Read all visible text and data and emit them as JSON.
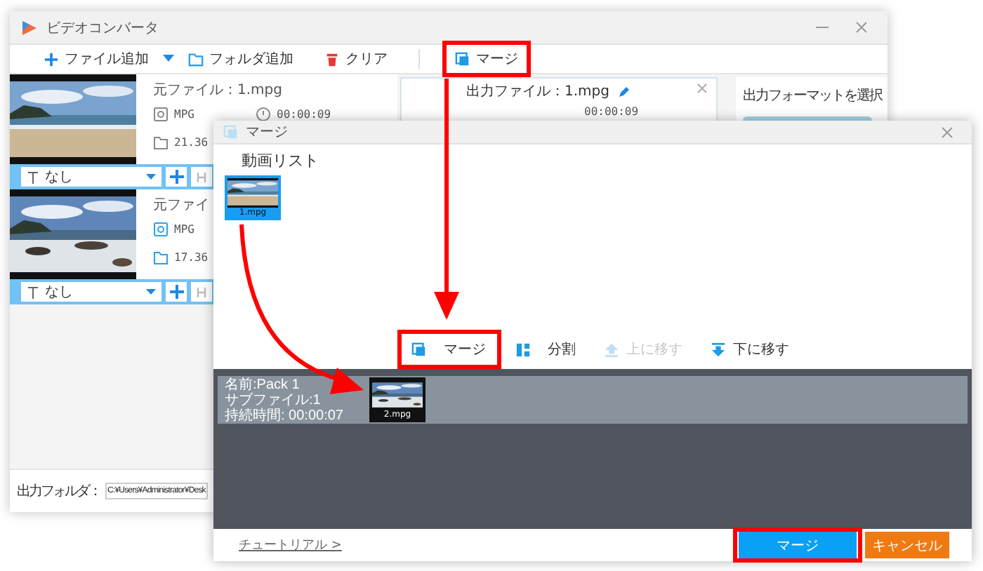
{
  "main_window": {
    "title": "ビデオコンバータ",
    "toolbar": [
      {
        "label": "ファイル追加",
        "kind": "add",
        "highlighted": false
      },
      {
        "label": "フォルダ追加",
        "kind": "folder",
        "highlighted": false
      },
      {
        "label": "クリア",
        "kind": "clear",
        "highlighted": false
      },
      {
        "label": "マージ",
        "kind": "merge",
        "highlighted": true
      }
    ],
    "files": [
      {
        "source": "元ファイル：1.mpg",
        "format": "MPG",
        "duration": "00:00:09",
        "size": "21.36",
        "subtitle": "なし"
      },
      {
        "source": "元ファイ",
        "format": "MPG",
        "size": "17.36",
        "subtitle": "なし"
      }
    ],
    "output_card": {
      "file": "出力ファイル：1.mpg",
      "duration": "00:00:09"
    },
    "format_panel": {
      "title": "出力フォーマットを選択"
    },
    "output_folder": {
      "label": "出力フォルダ：",
      "path": "C:¥Users¥Administrator¥Desk"
    }
  },
  "dialog": {
    "title": "マージ",
    "list_title": "動画リスト",
    "videos": [
      {
        "name": "1.mpg",
        "selected": true
      }
    ],
    "actions": [
      {
        "label": "マージ",
        "kind": "merge",
        "disabled": false,
        "highlighted": true
      },
      {
        "label": "分割",
        "kind": "split",
        "disabled": false,
        "highlighted": false
      },
      {
        "label": "上に移す",
        "kind": "up",
        "disabled": true,
        "highlighted": false
      },
      {
        "label": "下に移す",
        "kind": "down",
        "disabled": false,
        "highlighted": false
      }
    ],
    "packs": [
      {
        "name": "名前:Pack 1",
        "subfiles": "サブファイル:1",
        "duration": "持続時間: 00:00:07",
        "videos": [
          {
            "name": "2.mpg"
          }
        ]
      }
    ],
    "tutorial": "チュートリアル >",
    "buttons": [
      {
        "label": "マージ",
        "kind": "primary",
        "highlighted": true
      },
      {
        "label": "キャンセル",
        "kind": "cancel",
        "highlighted": false
      }
    ]
  }
}
